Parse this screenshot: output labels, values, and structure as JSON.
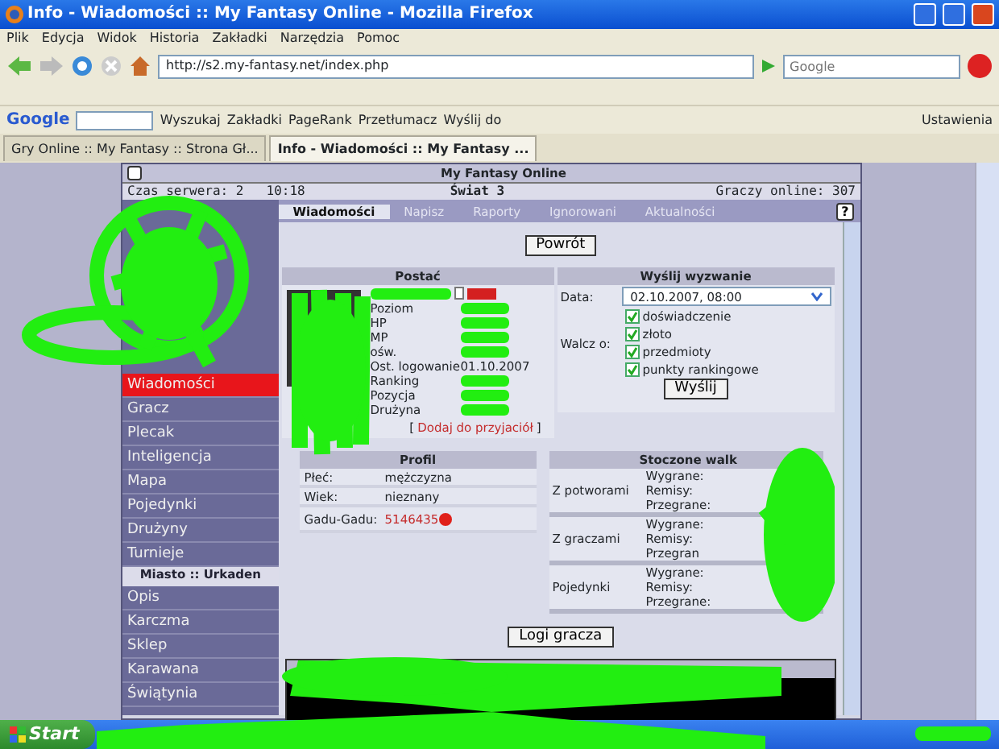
{
  "window": {
    "title": "Info - Wiadomości :: My Fantasy Online - Mozilla Firefox"
  },
  "menu": [
    "Plik",
    "Edycja",
    "Widok",
    "Historia",
    "Zakładki",
    "Narzędzia",
    "Pomoc"
  ],
  "address_bar": {
    "url": "http://s2.my-fantasy.net/index.php"
  },
  "search": {
    "placeholder": "Google"
  },
  "google_toolbar": {
    "logo": "Google",
    "items": [
      "Wyszukaj",
      "Zakładki",
      "PageRank",
      "Przetłumacz",
      "Wyślij do"
    ],
    "settings": "Ustawienia"
  },
  "browser_tabs": [
    {
      "label": "Gry Online :: My Fantasy :: Strona Gł...",
      "selected": false
    },
    {
      "label": "Info - Wiadomości :: My Fantasy ...",
      "selected": true
    }
  ],
  "game": {
    "title": "My Fantasy Online",
    "server_time": [
      "Czas serwera: 2",
      "10:18"
    ],
    "world": "Świat 3",
    "players_online": "Graczy online: 307"
  },
  "tabs": [
    {
      "label": "Wiadomości",
      "selected": true
    },
    {
      "label": "Napisz",
      "selected": false
    },
    {
      "label": "Raporty",
      "selected": false
    },
    {
      "label": "Ignorowani",
      "selected": false
    },
    {
      "label": "Aktualności",
      "selected": false
    }
  ],
  "help": "?",
  "sidebar": {
    "items": [
      {
        "label": "Wiadomości",
        "selected": true
      },
      {
        "label": "Gracz",
        "selected": false
      },
      {
        "label": "Plecak",
        "selected": false
      },
      {
        "label": "Inteligencja",
        "selected": false
      },
      {
        "label": "Mapa",
        "selected": false
      },
      {
        "label": "Pojedynki",
        "selected": false
      },
      {
        "label": "Drużyny",
        "selected": false
      },
      {
        "label": "Turnieje",
        "selected": false
      }
    ],
    "section": "Miasto :: Urkaden",
    "city_items": [
      "Opis",
      "Karczma",
      "Sklep",
      "Karawana",
      "Świątynia"
    ]
  },
  "back_button": "Powrót",
  "character": {
    "title": "Postać",
    "fields": [
      {
        "label": "Poziom"
      },
      {
        "label": "HP"
      },
      {
        "label": "MP"
      },
      {
        "label": "ośw."
      },
      {
        "label": "Ost. logowanie",
        "value": "01.10.2007"
      },
      {
        "label": "Ranking"
      },
      {
        "label": "Pozycja"
      },
      {
        "label": "Drużyna"
      }
    ],
    "add_friend": {
      "open": "[",
      "label": "Dodaj do przyjaciół",
      "close": "]"
    }
  },
  "challenge": {
    "title": "Wyślij wyzwanie",
    "date_label": "Data:",
    "date_value": "02.10.2007, 08:00",
    "fight_label": "Walcz o:",
    "options": [
      {
        "label": "doświadczenie",
        "checked": true
      },
      {
        "label": "złoto",
        "checked": true
      },
      {
        "label": "przedmioty",
        "checked": true
      },
      {
        "label": "punkty rankingowe",
        "checked": true
      }
    ],
    "submit": "Wyślij"
  },
  "profile": {
    "title": "Profil",
    "rows": [
      {
        "label": "Płeć:",
        "value": "mężczyzna",
        "kind": "text"
      },
      {
        "label": "Wiek:",
        "value": "nieznany",
        "kind": "text"
      },
      {
        "label": "Gadu-Gadu:",
        "value": "5146435",
        "kind": "link"
      }
    ]
  },
  "fights": {
    "title": "Stoczone walk",
    "groups": [
      {
        "label": "Z potworami",
        "results": [
          "Wygrane:",
          "Remisy:",
          "Przegrane:"
        ]
      },
      {
        "label": "Z graczami",
        "results": [
          "Wygrane:",
          "Remisy:",
          "Przegran"
        ]
      },
      {
        "label": "Pojedynki",
        "results": [
          "Wygrane:",
          "Remisy:",
          "Przegrane:"
        ]
      }
    ]
  },
  "logs_button": "Logi gracza",
  "taskbar": {
    "start": "Start"
  }
}
